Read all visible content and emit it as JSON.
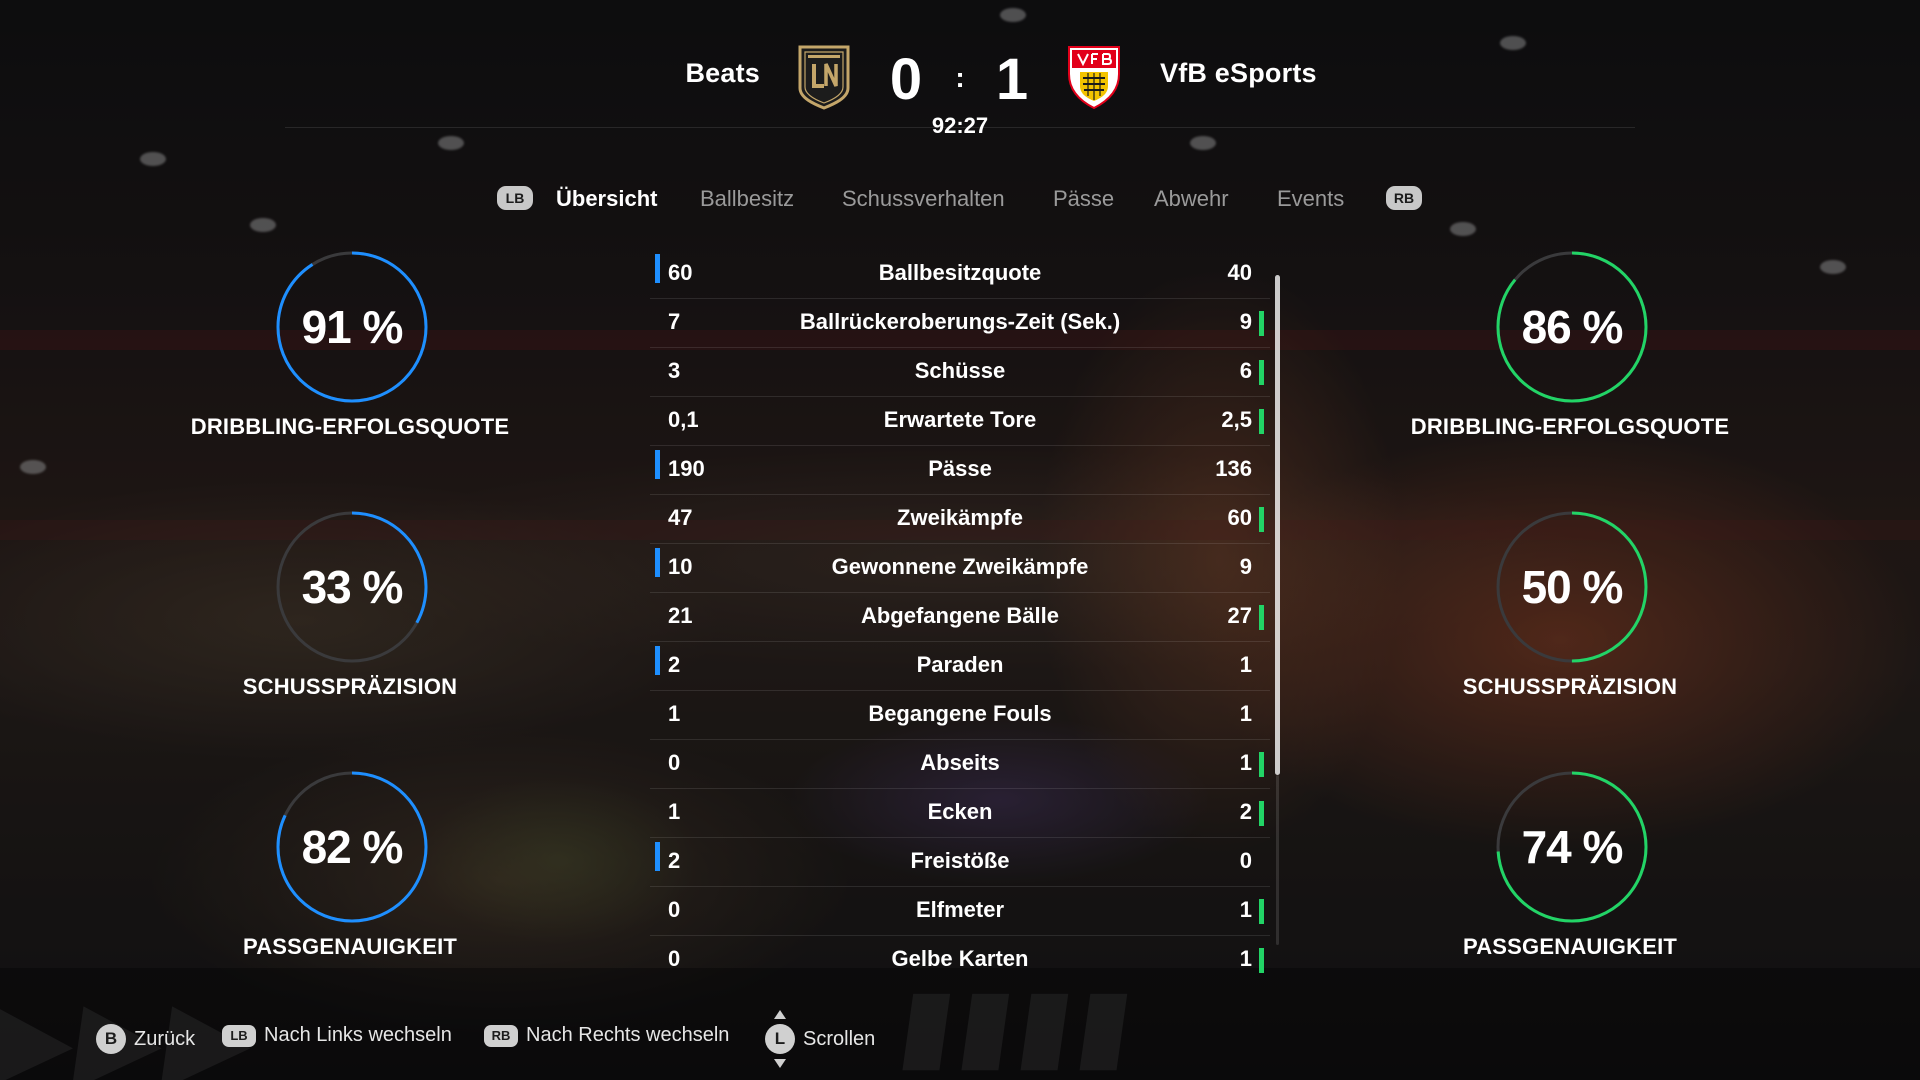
{
  "header": {
    "home_team": "Beats",
    "away_team": "VfB eSports",
    "home_score": "0",
    "score_separator": ":",
    "away_score": "1",
    "match_clock": "92:27",
    "home_crest_icon": "lafc-crest-icon",
    "away_crest_icon": "vfb-stuttgart-crest-icon"
  },
  "tabs": {
    "left_button": "LB",
    "right_button": "RB",
    "items": [
      {
        "label": "Übersicht",
        "active": true
      },
      {
        "label": "Ballbesitz",
        "active": false
      },
      {
        "label": "Schussverhalten",
        "active": false
      },
      {
        "label": "Pässe",
        "active": false
      },
      {
        "label": "Abwehr",
        "active": false
      },
      {
        "label": "Events",
        "active": false
      }
    ]
  },
  "colors": {
    "home_accent": "#1e8fff",
    "away_accent": "#22d466",
    "ring_track": "#3a3a3c"
  },
  "home_rings": [
    {
      "value": "91 %",
      "percent": 91,
      "label": "DRIBBLING-ERFOLGSQUOTE"
    },
    {
      "value": "33 %",
      "percent": 33,
      "label": "SCHUSSPRÄZISION"
    },
    {
      "value": "82 %",
      "percent": 82,
      "label": "PASSGENAUIGKEIT"
    }
  ],
  "away_rings": [
    {
      "value": "86 %",
      "percent": 86,
      "label": "DRIBBLING-ERFOLGSQUOTE"
    },
    {
      "value": "50 %",
      "percent": 50,
      "label": "SCHUSSPRÄZISION"
    },
    {
      "value": "74 %",
      "percent": 74,
      "label": "PASSGENAUIGKEIT"
    }
  ],
  "stats": [
    {
      "label": "Ballbesitzquote",
      "home": "60",
      "away": "40",
      "leader": "home"
    },
    {
      "label": "Ballrückeroberungs-Zeit (Sek.)",
      "home": "7",
      "away": "9",
      "leader": "away"
    },
    {
      "label": "Schüsse",
      "home": "3",
      "away": "6",
      "leader": "away"
    },
    {
      "label": "Erwartete Tore",
      "home": "0,1",
      "away": "2,5",
      "leader": "away"
    },
    {
      "label": "Pässe",
      "home": "190",
      "away": "136",
      "leader": "home"
    },
    {
      "label": "Zweikämpfe",
      "home": "47",
      "away": "60",
      "leader": "away"
    },
    {
      "label": "Gewonnene Zweikämpfe",
      "home": "10",
      "away": "9",
      "leader": "home"
    },
    {
      "label": "Abgefangene Bälle",
      "home": "21",
      "away": "27",
      "leader": "away"
    },
    {
      "label": "Paraden",
      "home": "2",
      "away": "1",
      "leader": "home"
    },
    {
      "label": "Begangene Fouls",
      "home": "1",
      "away": "1",
      "leader": "none"
    },
    {
      "label": "Abseits",
      "home": "0",
      "away": "1",
      "leader": "away"
    },
    {
      "label": "Ecken",
      "home": "1",
      "away": "2",
      "leader": "away"
    },
    {
      "label": "Freistöße",
      "home": "2",
      "away": "0",
      "leader": "home"
    },
    {
      "label": "Elfmeter",
      "home": "0",
      "away": "1",
      "leader": "away"
    },
    {
      "label": "Gelbe Karten",
      "home": "0",
      "away": "1",
      "leader": "away"
    }
  ],
  "footer": {
    "back_button": "B",
    "back_label": "Zurück",
    "left_button": "LB",
    "left_label": "Nach Links wechseln",
    "right_button": "RB",
    "right_label": "Nach Rechts wechseln",
    "scroll_button": "L",
    "scroll_label": "Scrollen"
  }
}
